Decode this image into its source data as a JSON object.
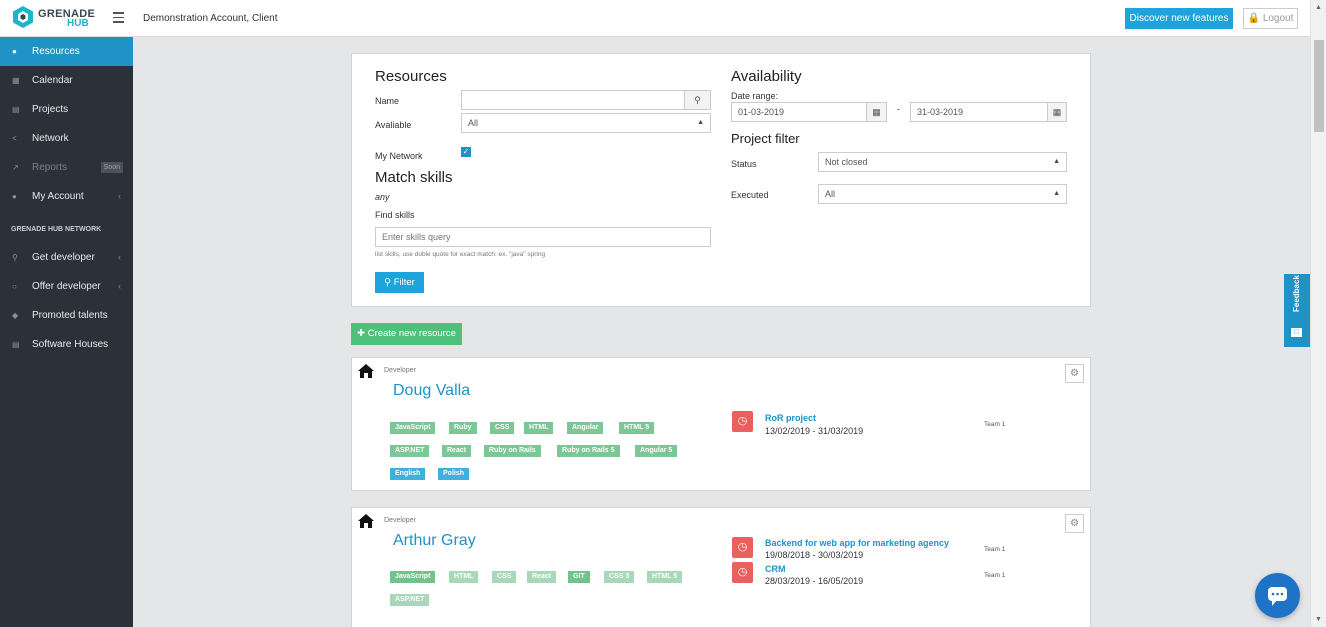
{
  "topbar": {
    "logo_line1": "GRENADE",
    "logo_line2": "HUB",
    "account": "Demonstration Account, Client",
    "discover_label": "Discover new features",
    "logout_label": "Logout"
  },
  "sidebar": {
    "items": [
      {
        "label": "Resources",
        "icon": "users-icon"
      },
      {
        "label": "Calendar",
        "icon": "calendar-icon"
      },
      {
        "label": "Projects",
        "icon": "projects-icon"
      },
      {
        "label": "Network",
        "icon": "share-icon"
      },
      {
        "label": "Reports",
        "icon": "chart-icon",
        "badge": "Soon"
      },
      {
        "label": "My Account",
        "icon": "user-icon"
      }
    ],
    "network_heading": "GRENADE HUB NETWORK",
    "network_items": [
      {
        "label": "Get developer",
        "icon": "search-icon"
      },
      {
        "label": "Offer developer",
        "icon": "tag-icon"
      },
      {
        "label": "Promoted talents",
        "icon": "diamond-icon"
      },
      {
        "label": "Software Houses",
        "icon": "building-icon"
      }
    ]
  },
  "filter": {
    "resources_title": "Resources",
    "name_label": "Name",
    "name_value": "",
    "available_label": "Avaliable",
    "available_value": "All",
    "my_network_label": "My Network",
    "my_network_checked": true,
    "match_title": "Match skills",
    "match_mode": "any",
    "find_skills_label": "Find skills",
    "skills_placeholder": "Enter skills query",
    "skills_hint": "list skills, use doble quote for exact match: ex. \"java\" spring",
    "filter_button": "Filter",
    "availability_title": "Availability",
    "date_range_label": "Date range:",
    "date_from": "01-03-2019",
    "date_separator": "-",
    "date_to": "31-03-2019",
    "project_filter_title": "Project filter",
    "status_label": "Status",
    "status_value": "Not closed",
    "executed_label": "Executed",
    "executed_value": "All"
  },
  "create_button": "Create new resource",
  "resources": [
    {
      "role": "Developer",
      "name": "Doug Valla",
      "skills": [
        "JavaScript",
        "Ruby",
        "CSS",
        "HTML",
        "Angular",
        "HTML 5",
        "ASP.NET",
        "React",
        "Ruby on Rails",
        "Ruby on Rails 5",
        "Angular 5"
      ],
      "languages": [
        "English",
        "Polish"
      ],
      "projects": [
        {
          "name": "RoR project",
          "dates": "13/02/2019 - 31/03/2019",
          "team": "Team 1"
        }
      ]
    },
    {
      "role": "Developer",
      "name": "Arthur Gray",
      "skills": [
        "JavaScript",
        "HTML",
        "CSS",
        "React",
        "GIT",
        "CSS 3",
        "HTML 5",
        "ASP.NET"
      ],
      "projects": [
        {
          "name": "Backend for web app for marketing agency",
          "dates": "19/08/2018 - 30/03/2019",
          "team": "Team 1"
        },
        {
          "name": "CRM",
          "dates": "28/03/2019 - 16/05/2019",
          "team": "Team 1"
        }
      ]
    }
  ],
  "feedback_label": "Feedback"
}
